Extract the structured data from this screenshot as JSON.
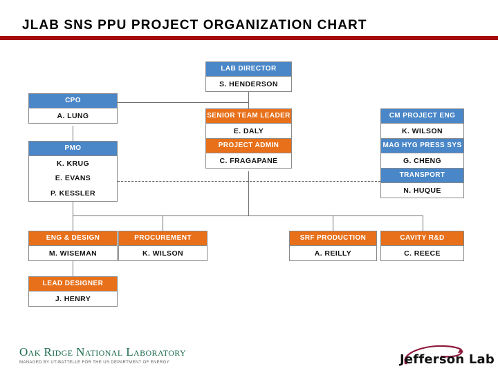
{
  "slide": {
    "title": "JLAB SNS PPU PROJECT ORGANIZATION CHART",
    "rule_color": "#a50b0b",
    "background": "#ffffff"
  },
  "palette": {
    "blue_header": "#4a87c8",
    "orange_header": "#e8701a",
    "box_border": "#8a8a8a",
    "name_text": "#111111",
    "header_text": "#ffffff",
    "connector": "#6e6e6e",
    "ornl_green": "#1c6b4a",
    "jlab_crimson": "#8e1a3c"
  },
  "chart_nodes": {
    "lab_director": {
      "role": "LAB DIRECTOR",
      "names": [
        "S. HENDERSON"
      ],
      "color": "blue"
    },
    "cpo": {
      "role": "CPO",
      "names": [
        "A. LUNG"
      ],
      "color": "blue"
    },
    "pmo": {
      "role": "PMO",
      "names": [
        "K. KRUG",
        "E. EVANS",
        "P. KESSLER"
      ],
      "color": "blue"
    },
    "senior_team_leader": {
      "role": "SENIOR TEAM LEADER",
      "names": [
        "E. DALY"
      ],
      "color": "orange"
    },
    "project_admin": {
      "role": "PROJECT ADMIN",
      "names": [
        "C. FRAGAPANE"
      ],
      "color": "orange"
    },
    "cm_project_eng": {
      "role": "CM PROJECT ENG",
      "names": [
        "K. WILSON"
      ],
      "color": "blue"
    },
    "mag_hyg_press_sys": {
      "role": "MAG HYG PRESS SYS",
      "names": [
        "G. CHENG"
      ],
      "color": "blue"
    },
    "transport": {
      "role": "TRANSPORT",
      "names": [
        "N. HUQUE"
      ],
      "color": "blue"
    },
    "eng_and_design": {
      "role": "ENG & DESIGN",
      "names": [
        "M. WISEMAN"
      ],
      "color": "orange"
    },
    "procurement": {
      "role": "PROCUREMENT",
      "names": [
        "K. WILSON"
      ],
      "color": "orange"
    },
    "srf_production": {
      "role": "SRF PRODUCTION",
      "names": [
        "A. REILLY"
      ],
      "color": "orange"
    },
    "cavity_rnd": {
      "role": "CAVITY R&D",
      "names": [
        "C. REECE"
      ],
      "color": "orange"
    },
    "lead_designer": {
      "role": "LEAD DESIGNER",
      "names": [
        "J. HENRY"
      ],
      "color": "orange"
    }
  },
  "footer": {
    "ornl_name": "Oak Ridge National Laboratory",
    "ornl_tagline": "MANAGED BY UT-BATTELLE FOR THE US DEPARTMENT OF ENERGY",
    "jlab_name": "Jefferson Lab"
  }
}
